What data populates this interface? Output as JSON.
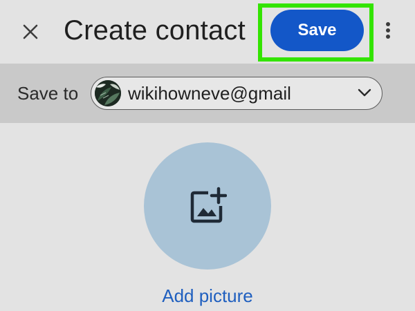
{
  "header": {
    "title": "Create contact",
    "save_label": "Save",
    "icons": {
      "close": "close-icon",
      "more": "more-vert-icon"
    }
  },
  "account": {
    "label": "Save to",
    "email": "wikihowneve@gmail",
    "dropdown_icon": "chevron-down-icon"
  },
  "photo": {
    "icon": "add-photo-icon",
    "add_label": "Add picture"
  },
  "colors": {
    "accent": "#1357c8",
    "highlight": "#33e400",
    "link": "#1f5fbf",
    "photo_bg": "#a9c3d6"
  }
}
